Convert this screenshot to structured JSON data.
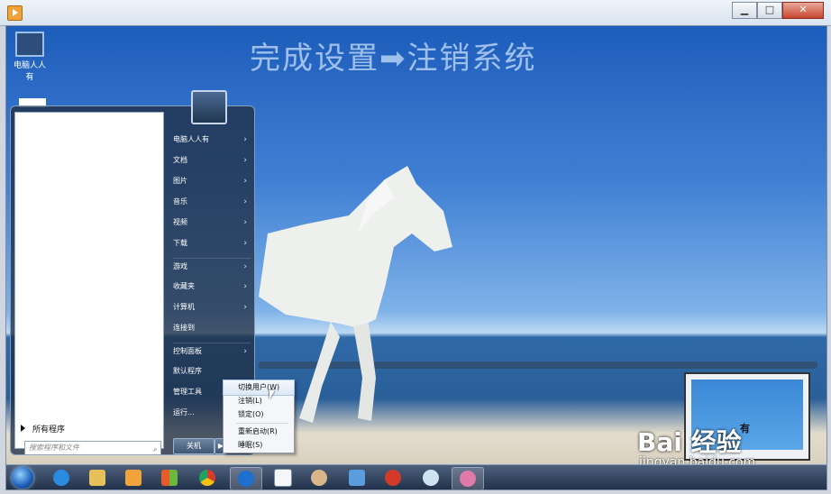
{
  "window": {
    "controls": {
      "minimize": "▁",
      "maximize": "□",
      "close": "✕"
    }
  },
  "overlay_title": "完成设置➡注销系统",
  "desktop": {
    "icon_label": "电脑人人有"
  },
  "start_menu": {
    "all_programs": "所有程序",
    "search_placeholder": "搜索程序和文件",
    "right_items": [
      {
        "label": "电脑人人有",
        "submenu": true
      },
      {
        "label": "文档",
        "submenu": true
      },
      {
        "label": "图片",
        "submenu": true
      },
      {
        "label": "音乐",
        "submenu": true
      },
      {
        "label": "视频",
        "submenu": true
      },
      {
        "label": "下载",
        "submenu": true
      },
      {
        "label": "游戏",
        "submenu": true
      },
      {
        "label": "收藏夹",
        "submenu": true
      },
      {
        "label": "计算机",
        "submenu": true
      },
      {
        "label": "连接到",
        "submenu": false
      },
      {
        "label": "控制面板",
        "submenu": true
      },
      {
        "label": "默认程序",
        "submenu": false
      },
      {
        "label": "管理工具",
        "submenu": true
      },
      {
        "label": "运行...",
        "submenu": false
      }
    ],
    "shutdown_label": "关机",
    "shutdown_arrow": "▶"
  },
  "shutdown_submenu": [
    {
      "label": "切换用户(W)"
    },
    {
      "label": "注销(L)"
    },
    {
      "label": "锁定(O)"
    },
    {
      "label": "重新启动(R)"
    },
    {
      "label": "睡眠(S)"
    }
  ],
  "laptop_caption": "有",
  "watermark": {
    "main": "Bai 经验",
    "sub": "jingyan.baidu.com"
  },
  "taskbar_icons": [
    "start-orb-icon",
    "ie-icon",
    "folder-icon",
    "media-player-icon",
    "windows-flag-icon",
    "chrome-icon",
    "qq-icon",
    "document-icon",
    "paint-icon",
    "network-icon",
    "chess-icon",
    "gear-icon",
    "monkey-icon"
  ],
  "colors": {
    "accent": "#1d5fb8"
  }
}
